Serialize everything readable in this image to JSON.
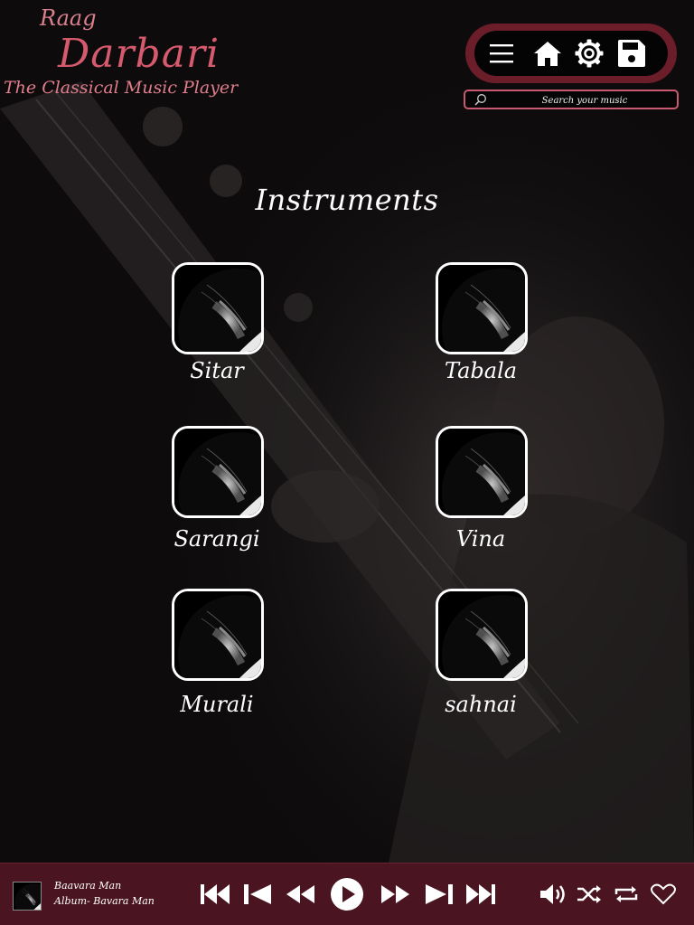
{
  "brand": {
    "line1": "Raag",
    "line2": "Darbari",
    "tagline": "The Classical Music Player"
  },
  "toolbar": {
    "icons": [
      "menu-icon",
      "home-icon",
      "settings-icon",
      "save-icon"
    ]
  },
  "search": {
    "placeholder": "Search your music",
    "icon": "search-icon"
  },
  "main": {
    "title": "Instruments",
    "instruments": [
      {
        "label": "Sitar"
      },
      {
        "label": "Tabala"
      },
      {
        "label": "Sarangi"
      },
      {
        "label": "Vina"
      },
      {
        "label": "Murali"
      },
      {
        "label": "sahnai"
      }
    ]
  },
  "player": {
    "song_title": "Baavara Man",
    "album": "Album- Bavara Man",
    "controls": [
      "skip-start-icon",
      "previous-icon",
      "rewind-icon",
      "play-icon",
      "fast-forward-icon",
      "next-icon",
      "skip-end-icon"
    ],
    "right_controls": [
      "volume-icon",
      "shuffle-icon",
      "repeat-icon",
      "heart-icon"
    ]
  },
  "colors": {
    "accent": "#d55a6e",
    "toolbar_bg": "#6b1e2a",
    "player_bg": "#4a1420",
    "page_bg": "#0d0b0c"
  }
}
